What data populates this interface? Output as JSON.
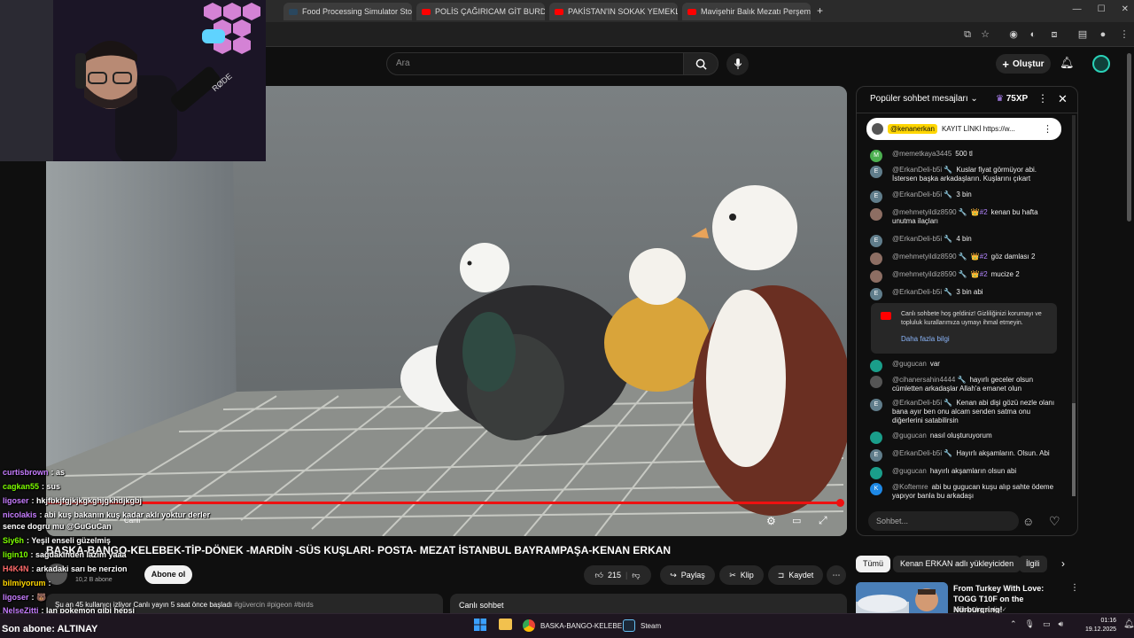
{
  "browser": {
    "tabs": [
      {
        "label": "Food Processing Simulator Sto",
        "favicon_color": "#2a475e"
      },
      {
        "label": "POLİS ÇAĞIRICAM GİT BURDAN",
        "favicon_color": "#ff0000"
      },
      {
        "label": "PAKİSTAN'IN SOKAK YEMEKLE",
        "favicon_color": "#ff0000"
      },
      {
        "label": "Mavişehir Balık Mezatı Perşemb",
        "favicon_color": "#ff0000"
      }
    ],
    "new_tab": "+"
  },
  "youtube_header": {
    "search_placeholder": "Ara",
    "create_label": "Oluştur"
  },
  "video": {
    "title": "BASKA-BANGO-KELEBEK-TİP-DÖNEK -MARDİN -SÜS KUŞLARI- POSTA- MEZAT İSTANBUL BAYRAMPAŞA-KENAN ERKAN",
    "live_label": "Canlı",
    "subscribers": "10,2 B abone",
    "subscribe_label": "Abone ol",
    "likes": "215",
    "share_label": "Paylaş",
    "clip_label": "Klip",
    "save_label": "Kaydet",
    "description_line": "Şu an 45 kullanıcı izliyor  Canlı yayın 5 saat önce başladı",
    "description_tags": "#güvercin #pigeon #birds",
    "live_chat_label": "Canlı sohbet"
  },
  "chat": {
    "title": "Popüler sohbet mesajları",
    "xp": "75XP",
    "pinned_user": "@kenanerkan",
    "pinned_text": "KAYIT LİNKİ https://w...",
    "messages": [
      {
        "user": "@memetkaya3445",
        "text": "500 tl",
        "initial": "M",
        "color": "#4caf50"
      },
      {
        "user": "@ErkanDeli-b5i 🔧",
        "text": "Kuslar fiyat görmüyor abi. İstersen başka arkadaşların. Kuşlarını çıkart",
        "initial": "E",
        "color": "#607d8b"
      },
      {
        "user": "@ErkanDeli-b5i 🔧",
        "text": "3 bin",
        "initial": "E",
        "color": "#607d8b"
      },
      {
        "user": "@mehmetyildiz8590 🔧",
        "badge": "👑#2",
        "text": "kenan bu hafta unutma ilaçları",
        "initial": "",
        "color": "#8d6e63"
      },
      {
        "user": "@ErkanDeli-b5i 🔧",
        "text": "4 bin",
        "initial": "E",
        "color": "#607d8b"
      },
      {
        "user": "@mehmetyildiz8590 🔧",
        "badge": "👑#2",
        "text": "göz damlası 2",
        "initial": "",
        "color": "#8d6e63"
      },
      {
        "user": "@mehmetyildiz8590 🔧",
        "badge": "👑#2",
        "text": "mucize 2",
        "initial": "",
        "color": "#8d6e63"
      },
      {
        "user": "@ErkanDeli-b5i 🔧",
        "text": "3 bin abi",
        "initial": "E",
        "color": "#607d8b"
      }
    ],
    "welcome_text": "Canlı sohbete hoş geldiniz! Gizliliğinizi korumayı ve topluluk kurallarımıza uymayı ihmal etmeyin.",
    "welcome_link": "Daha fazla bilgi",
    "messages_after": [
      {
        "user": "@gugucan",
        "text": "var",
        "initial": "",
        "color": "#1a9e8a"
      },
      {
        "user": "@cihanersahin4444 🔧",
        "text": "hayırlı geceler olsun cümletten arkadaşlar Allah'a emanet olun",
        "initial": "",
        "color": "#555"
      },
      {
        "user": "@ErkanDeli-b5i 🔧",
        "text": "Kenan abi dişi gözü nezle olanı bana ayır ben onu alcam senden satma onu diğerlerini satabilirsin",
        "initial": "E",
        "color": "#607d8b"
      },
      {
        "user": "@gugucan",
        "text": "nasıl oluşturuyorum",
        "initial": "",
        "color": "#1a9e8a"
      },
      {
        "user": "@ErkanDeli-b5i 🔧",
        "text": "Hayırlı akşamların. Olsun. Abi",
        "initial": "E",
        "color": "#607d8b"
      },
      {
        "user": "@gugucan",
        "text": "hayırlı akşamların olsun abi",
        "initial": "",
        "color": "#1a9e8a"
      },
      {
        "user": "@Koftemre",
        "text": "abi bu gugucan kuşu alıp sahte ödeme yapıyor banla bu arkadaşı",
        "initial": "K",
        "color": "#1e88e5"
      }
    ],
    "input_placeholder": "Sohbet..."
  },
  "recommendations": {
    "chips": [
      "Tümü",
      "Kenan ERKAN adlı yükleyiciden",
      "İlgili"
    ],
    "video_title": "From Turkey With Love: TOGG T10F on the Nürburgring!",
    "video_channel": "Misha Charoudin ✓"
  },
  "overlay_chat": [
    {
      "user": "curtisbrown",
      "text": ": as",
      "color": "#c77dff"
    },
    {
      "user": "cagkan55",
      "text": ": sus",
      "color": "#7cfc00"
    },
    {
      "user": "ligoser",
      "text": ": hkjfbkjfgjkjkgkghjgkhdjkgbj",
      "color": "#c77dff"
    },
    {
      "user": "nicolakis",
      "text": ": abi kuş bakanın kuş kadar aklı yoktur derler",
      "color": "#c77dff"
    },
    {
      "user": "",
      "text": "sence dogru mu @GuGuCan",
      "color": "#fff"
    },
    {
      "user": "Siy6h",
      "text": ": Yeşil enseli güzelmiş",
      "color": "#7cfc00"
    },
    {
      "user": "ligin10",
      "text": ": sağdakinden lazım yaaa",
      "color": "#7cfc00"
    },
    {
      "user": "H4K4N",
      "text": ": arkadaki sarı be nerzion",
      "color": "#ff6b6b"
    },
    {
      "user": "bilmiyorum",
      "text": ": ",
      "color": "#ffd600"
    },
    {
      "user": "ligoser",
      "text": ": 🐻",
      "color": "#c77dff"
    },
    {
      "user": "NelseZitti",
      "text": ": lan pokemon gibi hepsi",
      "color": "#c77dff"
    }
  ],
  "stream_footer": "Son abone: ALTINAY",
  "taskbar": {
    "apps": [
      {
        "label": "BASKA-BANGO-KELEBE",
        "color": "#fbbc04"
      },
      {
        "label": "Steam",
        "color": "#1b2838"
      }
    ],
    "time": "01:16",
    "date": "19.12.2025"
  }
}
